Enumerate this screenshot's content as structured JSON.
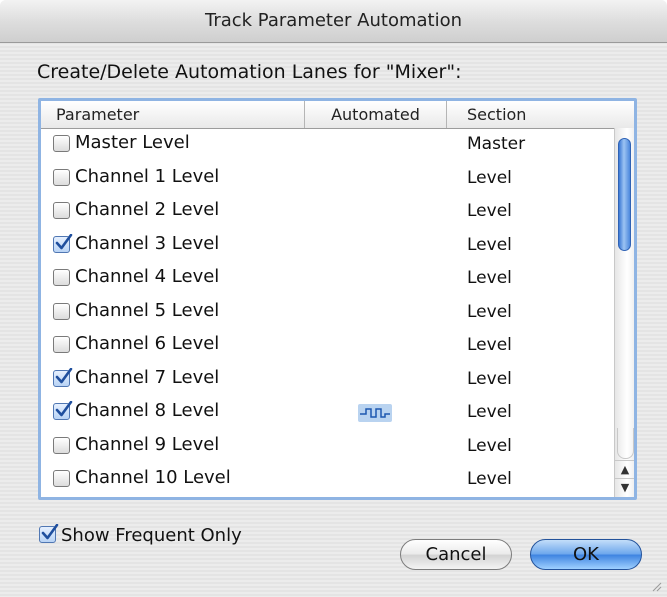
{
  "window": {
    "title": "Track Parameter Automation"
  },
  "heading": "Create/Delete Automation Lanes for \"Mixer\":",
  "table": {
    "columns": [
      "Parameter",
      "Automated",
      "Section"
    ],
    "rows": [
      {
        "parameter": "Master Level",
        "checked": false,
        "automated": false,
        "section": "Master"
      },
      {
        "parameter": "Channel 1 Level",
        "checked": false,
        "automated": false,
        "section": "Level"
      },
      {
        "parameter": "Channel 2 Level",
        "checked": false,
        "automated": false,
        "section": "Level"
      },
      {
        "parameter": "Channel 3 Level",
        "checked": true,
        "automated": false,
        "section": "Level"
      },
      {
        "parameter": "Channel 4 Level",
        "checked": false,
        "automated": false,
        "section": "Level"
      },
      {
        "parameter": "Channel 5 Level",
        "checked": false,
        "automated": false,
        "section": "Level"
      },
      {
        "parameter": "Channel 6 Level",
        "checked": false,
        "automated": false,
        "section": "Level"
      },
      {
        "parameter": "Channel 7 Level",
        "checked": true,
        "automated": false,
        "section": "Level"
      },
      {
        "parameter": "Channel 8 Level",
        "checked": true,
        "automated": true,
        "section": "Level"
      },
      {
        "parameter": "Channel 9 Level",
        "checked": false,
        "automated": false,
        "section": "Level"
      },
      {
        "parameter": "Channel 10 Level",
        "checked": false,
        "automated": false,
        "section": "Level"
      }
    ],
    "automated_icon": "automation-envelope-icon"
  },
  "show_frequent": {
    "label": "Show Frequent Only",
    "checked": true
  },
  "buttons": {
    "cancel": "Cancel",
    "ok": "OK"
  },
  "colors": {
    "accent": "#3c82e0",
    "selection_border": "#8fb4e3",
    "checkmark": "#1f4f9e"
  }
}
